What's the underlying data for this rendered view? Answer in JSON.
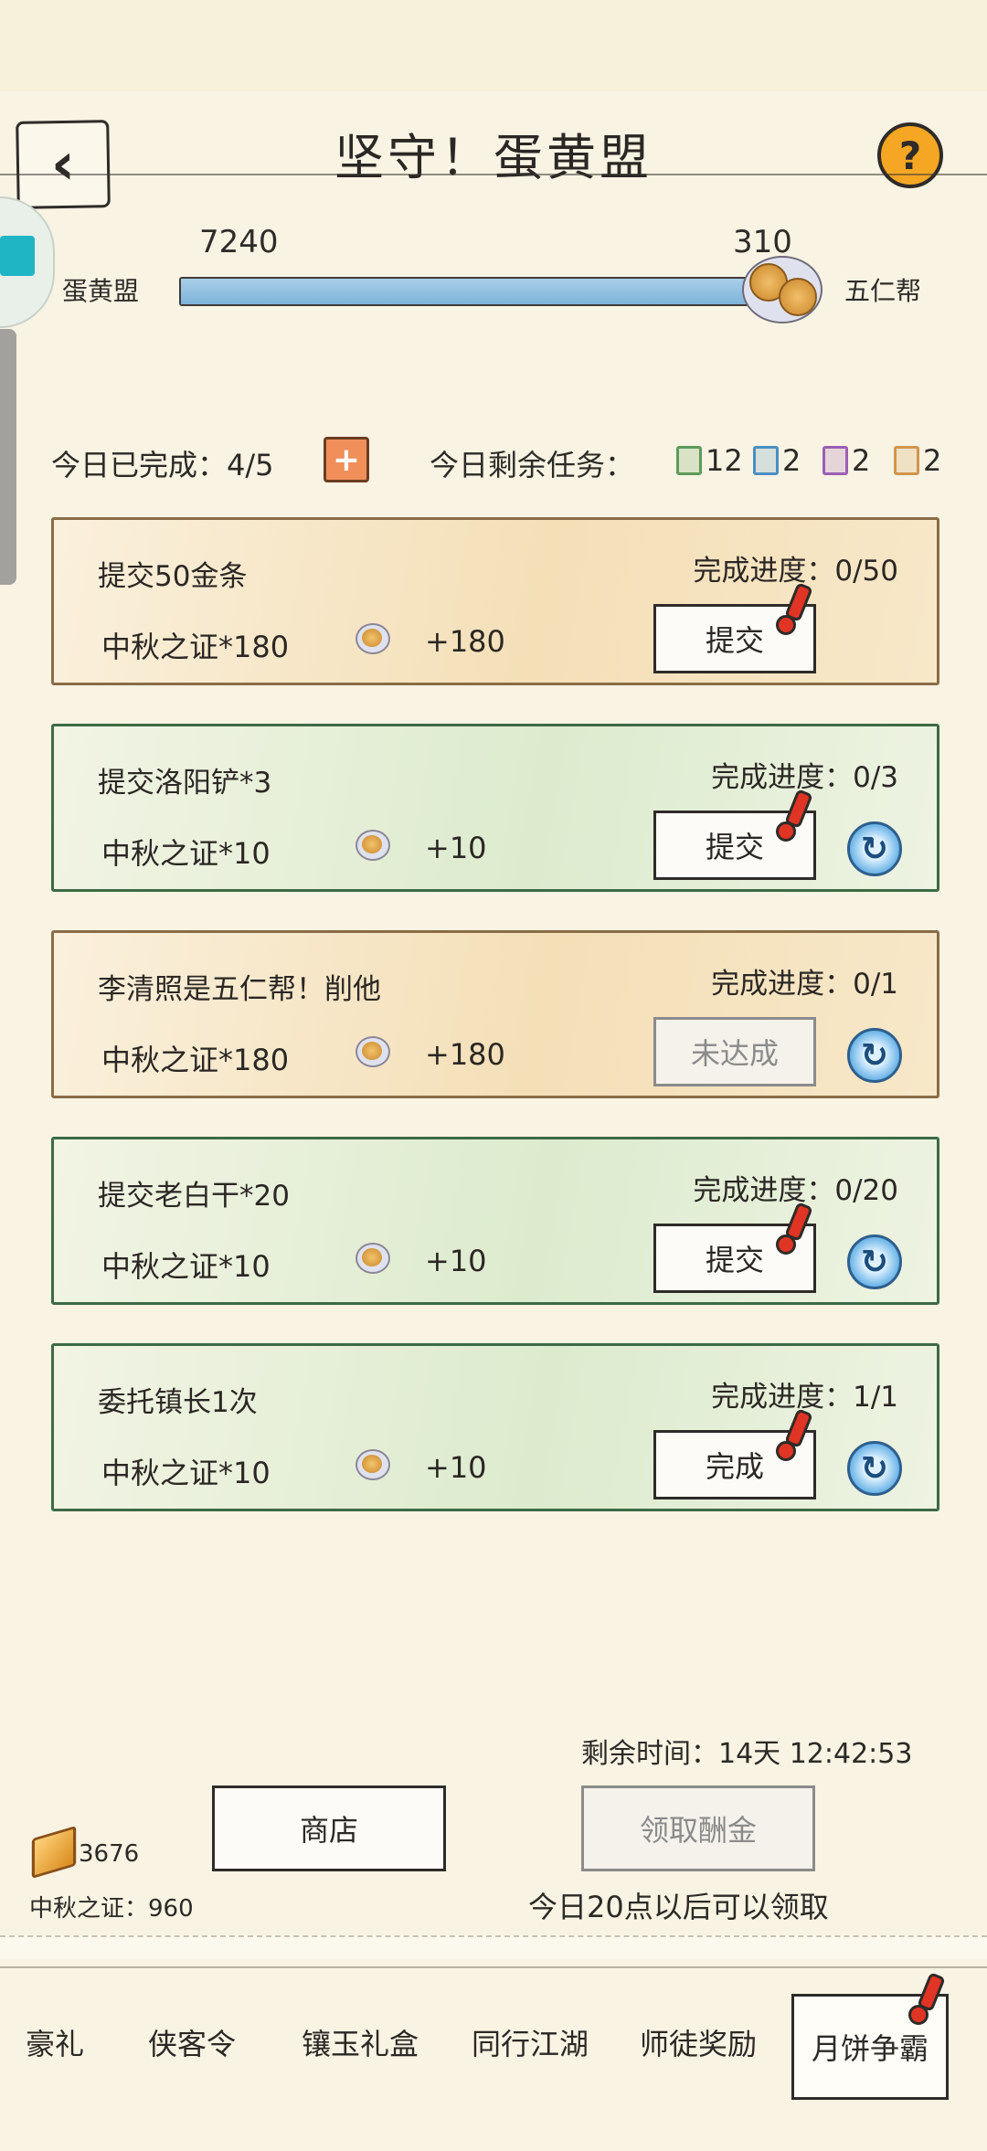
{
  "header": {
    "title": "坚守！蛋黄盟"
  },
  "battle": {
    "left_team": "蛋黄盟",
    "left_score": "7240",
    "right_team": "五仁帮",
    "right_score": "310",
    "progress_fraction": 0.959
  },
  "summary": {
    "done_label": "今日已完成：4/5",
    "remaining_label": "今日剩余任务：",
    "chips": [
      {
        "value": "12",
        "color": "#5d9b5a"
      },
      {
        "value": "2",
        "color": "#4a8fc0"
      },
      {
        "value": "2",
        "color": "#9b5fb5"
      },
      {
        "value": "2",
        "color": "#d1954c"
      }
    ]
  },
  "tasks": [
    {
      "title": "提交50金条",
      "progress": "完成进度：0/50",
      "reward": "中秋之证*180",
      "amount": "+180",
      "button": "提交"
    },
    {
      "title": "提交洛阳铲*3",
      "progress": "完成进度：0/3",
      "reward": "中秋之证*10",
      "amount": "+10",
      "button": "提交"
    },
    {
      "title": "李清照是五仁帮！削他",
      "progress": "完成进度：0/1",
      "reward": "中秋之证*180",
      "amount": "+180",
      "button": "未达成"
    },
    {
      "title": "提交老白干*20",
      "progress": "完成进度：0/20",
      "reward": "中秋之证*10",
      "amount": "+10",
      "button": "提交"
    },
    {
      "title": "委托镇长1次",
      "progress": "完成进度：1/1",
      "reward": "中秋之证*10",
      "amount": "+10",
      "button": "完成"
    }
  ],
  "footer": {
    "remaining_time": "剩余时间：14天 12:42:53",
    "shop_label": "商店",
    "claim_label": "领取酬金",
    "claim_note": "今日20点以后可以领取",
    "gold_count": "3676",
    "cert_count": "中秋之证：960"
  },
  "nav": {
    "items": [
      "豪礼",
      "侠客令",
      "镶玉礼盒",
      "同行江湖",
      "师徒奖励",
      "月饼争霸"
    ]
  }
}
